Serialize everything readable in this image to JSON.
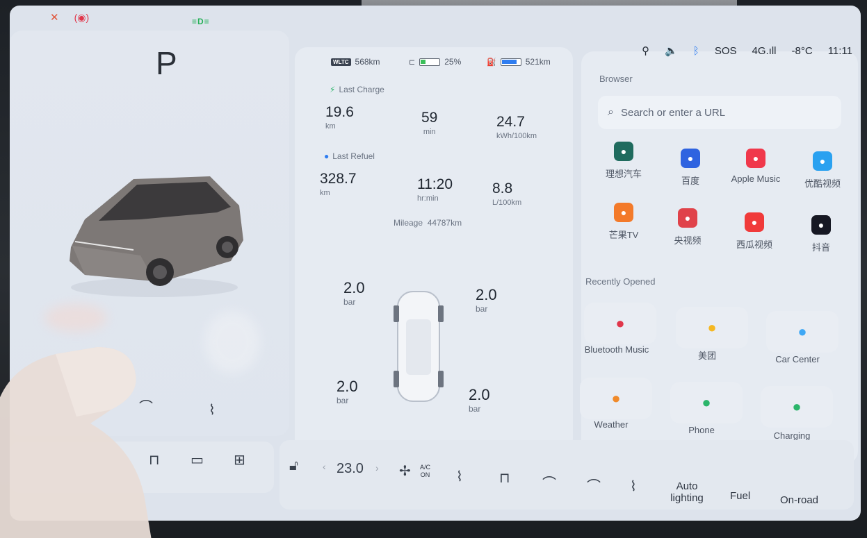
{
  "status_bar": {
    "left_icons": [
      "wrench-icon",
      "brake-warning-icon"
    ],
    "green_indicator": "≡D≡",
    "location_icon": "location-pin-icon",
    "volume_icon": "volume-icon",
    "bluetooth_icon": "bluetooth-icon",
    "sos": "SOS",
    "network": "4G.ıll",
    "temperature": "-8°C",
    "time": "11:11"
  },
  "vehicle": {
    "gear": "P"
  },
  "range": {
    "wltc_badge": "WLTC",
    "wltc_range": "568km",
    "battery_percent": "25%",
    "battery_fill": 0.25,
    "fuel_range": "521km",
    "fuel_fill": 0.8
  },
  "last_charge": {
    "label": "Last Charge",
    "distance": {
      "value": "19.6",
      "unit": "km"
    },
    "duration": {
      "value": "59",
      "unit": "min"
    },
    "consumption": {
      "value": "24.7",
      "unit": "kWh/100km"
    }
  },
  "last_refuel": {
    "label": "Last Refuel",
    "distance": {
      "value": "328.7",
      "unit": "km"
    },
    "duration": {
      "value": "11:20",
      "unit": "hr:min"
    },
    "consumption": {
      "value": "8.8",
      "unit": "L/100km"
    }
  },
  "mileage": {
    "label": "Mileage",
    "value": "44787km"
  },
  "tires": {
    "front_left": {
      "value": "2.0",
      "unit": "bar"
    },
    "front_right": {
      "value": "2.0",
      "unit": "bar"
    },
    "rear_left": {
      "value": "2.0",
      "unit": "bar"
    },
    "rear_right": {
      "value": "2.0",
      "unit": "bar"
    }
  },
  "browser": {
    "title": "Browser",
    "search_placeholder": "Search or enter a URL",
    "apps": [
      {
        "label": "理想汽车",
        "icon": "li-auto-icon",
        "color": "#1f6b5e"
      },
      {
        "label": "百度",
        "icon": "baidu-icon",
        "color": "#2f63e0"
      },
      {
        "label": "Apple Music",
        "icon": "apple-music-icon",
        "color": "#f0384b"
      },
      {
        "label": "优酷视频",
        "icon": "youku-icon",
        "color": "#2aa1f0"
      },
      {
        "label": "芒果TV",
        "icon": "mango-tv-icon",
        "color": "#f37a2a"
      },
      {
        "label": "央视频",
        "icon": "cctv-video-icon",
        "color": "#e0424a"
      },
      {
        "label": "西瓜视频",
        "icon": "xigua-icon",
        "color": "#f03a3a"
      },
      {
        "label": "抖音",
        "icon": "douyin-icon",
        "color": "#161823"
      }
    ]
  },
  "recent": {
    "title": "Recently Opened",
    "items": [
      {
        "label": "Bluetooth Music",
        "icon": "bluetooth-music-icon",
        "color": "#e0364a"
      },
      {
        "label": "美团",
        "icon": "meituan-icon",
        "color": "#f5b821"
      },
      {
        "label": "Car Center",
        "icon": "car-center-icon",
        "color": "#3fa8f5"
      },
      {
        "label": "Weather",
        "icon": "weather-icon",
        "color": "#f08a2a"
      },
      {
        "label": "Phone",
        "icon": "phone-icon",
        "color": "#2bb56a"
      },
      {
        "label": "Charging",
        "icon": "charging-icon",
        "color": "#2bb56a"
      }
    ]
  },
  "dock": {
    "temperature": "23.0",
    "ac_label": "A/C",
    "ac_state": "ON",
    "auto_lighting": "Auto lighting",
    "fuel": "Fuel",
    "on_road": "On-road"
  }
}
